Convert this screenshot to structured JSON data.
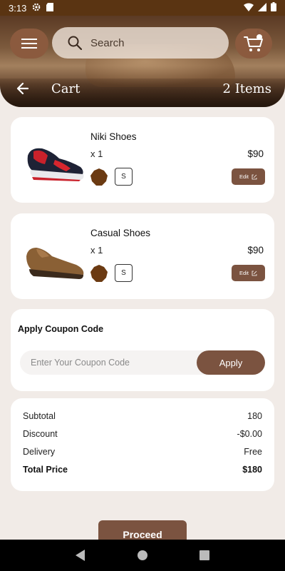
{
  "status": {
    "time": "3:13"
  },
  "header": {
    "search_placeholder": "Search",
    "cart_badge": "0",
    "cart_title": "Cart",
    "item_count": "2 Items"
  },
  "items": [
    {
      "name": "Niki Shoes",
      "qty": "x 1",
      "price": "$90",
      "color": "#6b3a12",
      "size": "S",
      "edit_label": "Edit"
    },
    {
      "name": "Casual Shoes",
      "qty": "x 1",
      "price": "$90",
      "color": "#6b3a12",
      "size": "S",
      "edit_label": "Edit"
    }
  ],
  "coupon": {
    "title": "Apply Coupon Code",
    "placeholder": "Enter Your Coupon Code",
    "apply_label": "Apply"
  },
  "summary": {
    "subtotal_label": "Subtotal",
    "subtotal_value": "180",
    "discount_label": "Discount",
    "discount_value": "-$0.00",
    "delivery_label": "Delivery",
    "delivery_value": "Free",
    "total_label": "Total Price",
    "total_value": "$180"
  },
  "proceed_label": "Proceed",
  "colors": {
    "brand": "#7b5340",
    "status_bar": "#5a3412",
    "background": "#f1ebe7"
  }
}
